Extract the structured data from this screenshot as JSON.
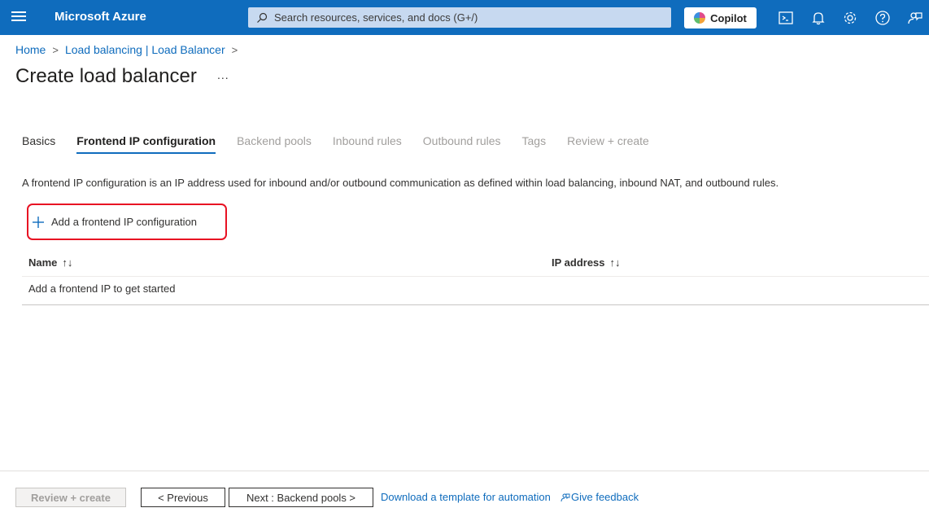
{
  "topbar": {
    "brand": "Microsoft Azure",
    "search_placeholder": "Search resources, services, and docs (G+/)",
    "copilot_label": "Copilot",
    "icons": [
      "menu-icon",
      "search-icon",
      "cloud-shell-icon",
      "bell-icon",
      "gear-icon",
      "help-icon",
      "feedback-icon"
    ]
  },
  "breadcrumb": {
    "items": [
      "Home",
      "Load balancing | Load Balancer"
    ],
    "separator": ">"
  },
  "page": {
    "title": "Create load balancer",
    "more": "..."
  },
  "tabs": [
    {
      "label": "Basics",
      "state": "enabled"
    },
    {
      "label": "Frontend IP configuration",
      "state": "active"
    },
    {
      "label": "Backend pools",
      "state": "disabled"
    },
    {
      "label": "Inbound rules",
      "state": "disabled"
    },
    {
      "label": "Outbound rules",
      "state": "disabled"
    },
    {
      "label": "Tags",
      "state": "disabled"
    },
    {
      "label": "Review + create",
      "state": "disabled"
    }
  ],
  "description": "A frontend IP configuration is an IP address used for inbound and/or outbound communication as defined within load balancing, inbound NAT, and outbound rules.",
  "add_button_label": "Add a frontend IP configuration",
  "table": {
    "columns": [
      "Name",
      "IP address"
    ],
    "sort_glyph": "↑↓",
    "empty_message": "Add a frontend IP to get started"
  },
  "footer": {
    "review_create": "Review + create",
    "previous": "< Previous",
    "next": "Next : Backend pools >",
    "download_template": "Download a template for automation",
    "give_feedback": "Give feedback"
  },
  "colors": {
    "azure_blue": "#0f6cbd",
    "highlight_red": "#e81123"
  }
}
